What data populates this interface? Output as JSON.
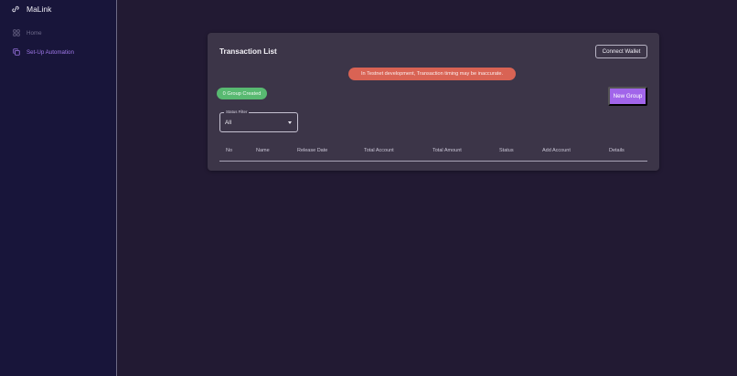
{
  "app": {
    "name": "MaLink"
  },
  "sidebar": {
    "items": [
      {
        "label": "Home",
        "icon": "grid-icon",
        "active": false
      },
      {
        "label": "Set-Up Automation",
        "icon": "copy-icon",
        "active": true
      }
    ]
  },
  "transactions": {
    "title": "Transaction List",
    "connect_wallet_label": "Connect Wallet",
    "warning": "In Testnet development, Transaction timing may be inaccurate.",
    "group_badge": "0 Group Created",
    "new_group_label": "New Group",
    "status_filter": {
      "label": "Status Filter",
      "value": "All"
    },
    "columns": [
      "No",
      "Name",
      "Release Date",
      "Total Account",
      "Total Amount",
      "Status",
      "Add Account",
      "Details"
    ],
    "rows": []
  },
  "colors": {
    "sidebar_bg": "#18153a",
    "page_bg": "#221a33",
    "card_bg": "#3c3548",
    "accent": "#a165ea",
    "warning": "#d96354",
    "success": "#58b971"
  }
}
